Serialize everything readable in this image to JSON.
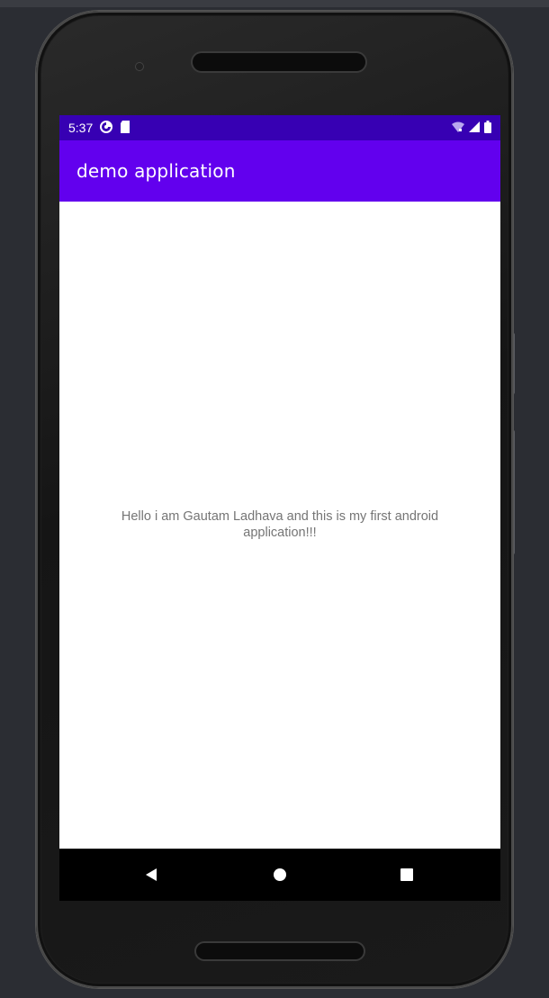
{
  "status_bar": {
    "time": "5:37",
    "icons": [
      "data-saver-icon",
      "sd-card-icon",
      "wifi-icon",
      "signal-icon",
      "battery-icon"
    ]
  },
  "app_bar": {
    "title": "demo application",
    "color": "#6200ee",
    "status_color": "#3700b3"
  },
  "main": {
    "message": "Hello i am Gautam Ladhava and this is my first android application!!!"
  },
  "nav_bar": {
    "buttons": [
      "back-icon",
      "home-icon",
      "recents-icon"
    ]
  }
}
